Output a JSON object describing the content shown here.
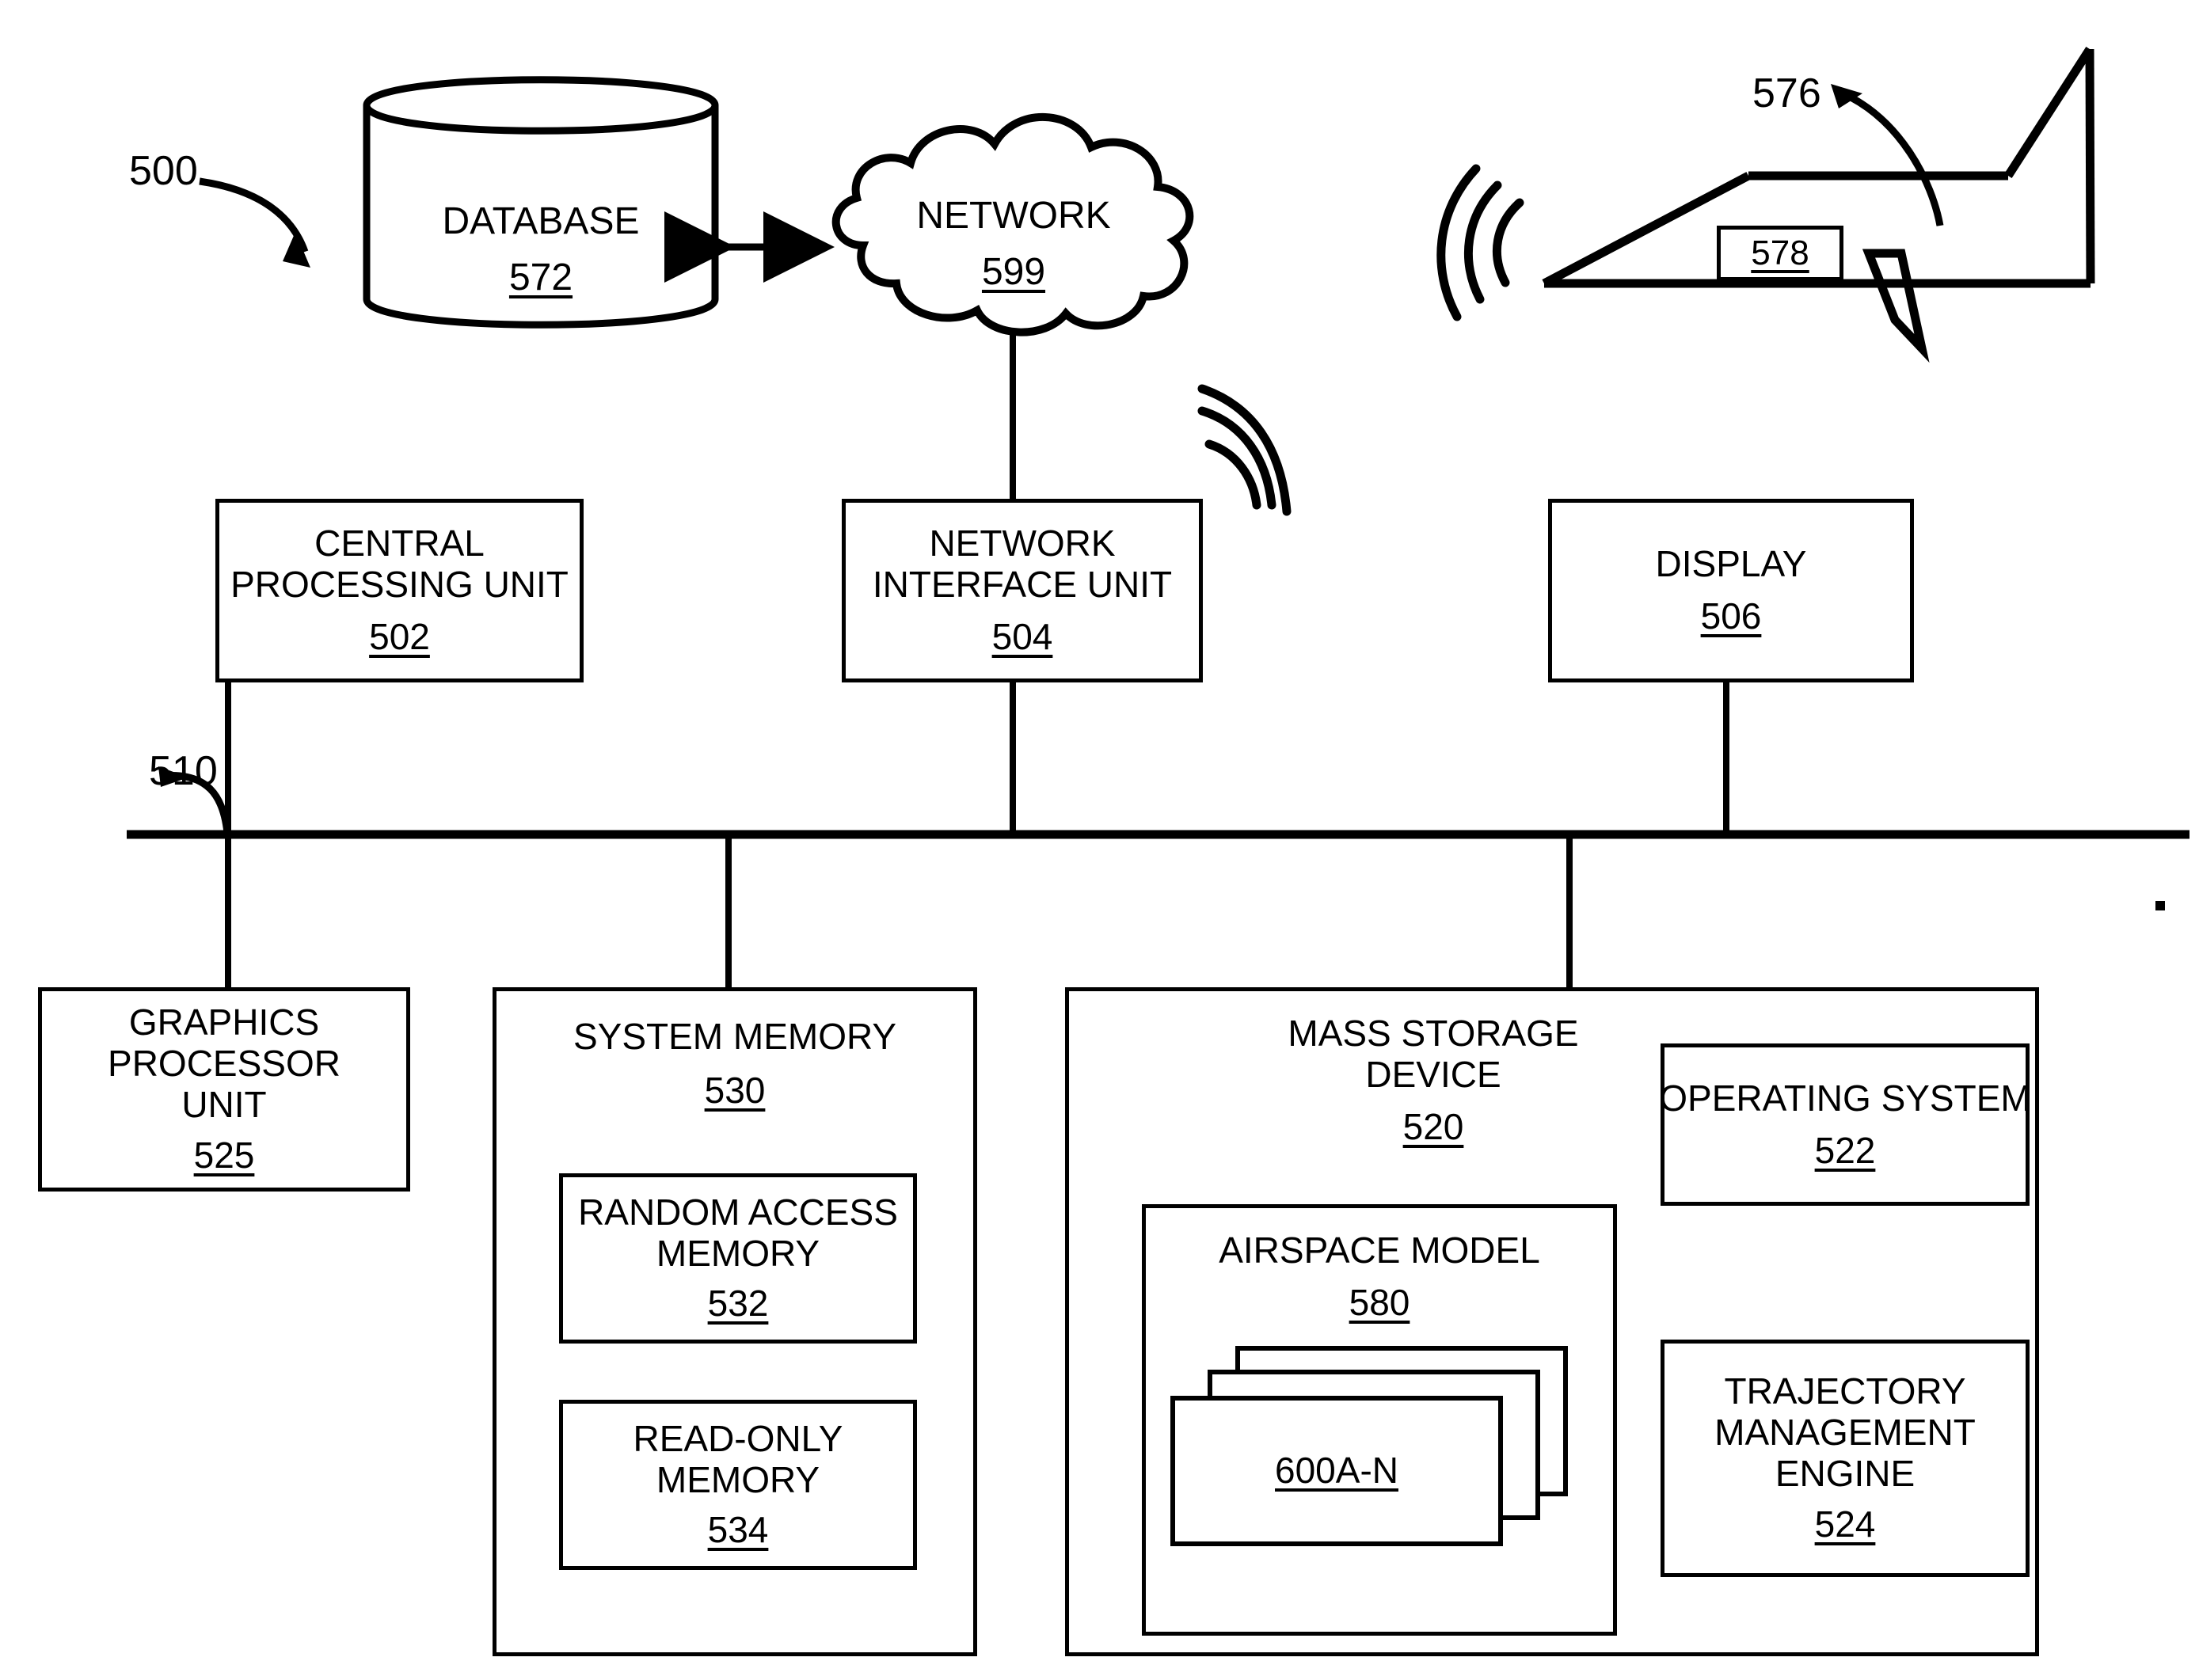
{
  "figure": {
    "kind": "patent-block-diagram",
    "system_ref": "500",
    "bus_ref": "510"
  },
  "nodes": {
    "database": {
      "label": "DATABASE",
      "ref": "572"
    },
    "network": {
      "label": "NETWORK",
      "ref": "599"
    },
    "aircraft": {
      "callout_ref": "576",
      "tag_ref": "578"
    },
    "cpu": {
      "line1": "CENTRAL",
      "line2": "PROCESSING UNIT",
      "ref": "502"
    },
    "network_interface": {
      "line1": "NETWORK",
      "line2": "INTERFACE UNIT",
      "ref": "504"
    },
    "display": {
      "label": "DISPLAY",
      "ref": "506"
    },
    "gpu": {
      "line1": "GRAPHICS",
      "line2": "PROCESSOR",
      "line3": "UNIT",
      "ref": "525"
    },
    "system_memory": {
      "label": "SYSTEM MEMORY",
      "ref": "530"
    },
    "ram": {
      "line1": "RANDOM ACCESS",
      "line2": "MEMORY",
      "ref": "532"
    },
    "rom": {
      "line1": "READ-ONLY",
      "line2": "MEMORY",
      "ref": "534"
    },
    "mass_storage": {
      "line1": "MASS STORAGE",
      "line2": "DEVICE",
      "ref": "520"
    },
    "airspace_model": {
      "label": "AIRSPACE MODEL",
      "ref": "580"
    },
    "airspace_sheets": {
      "ref": "600A-N"
    },
    "operating_system": {
      "label": "OPERATING SYSTEM",
      "ref": "522"
    },
    "trajectory_engine": {
      "line1": "TRAJECTORY",
      "line2": "MANAGEMENT",
      "line3": "ENGINE",
      "ref": "524"
    }
  },
  "colors": {
    "ink": "#000000",
    "paper": "#ffffff"
  }
}
